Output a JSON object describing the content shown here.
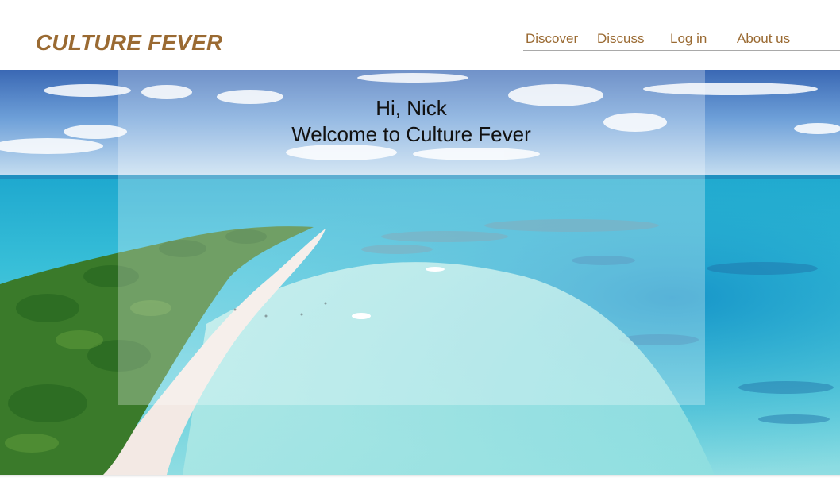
{
  "brand": {
    "name": "CULTURE FEVER",
    "color": "#9a6a32"
  },
  "nav": {
    "items": [
      {
        "label": "Discover"
      },
      {
        "label": "Discuss"
      },
      {
        "label": "Log in"
      },
      {
        "label": "About us"
      }
    ]
  },
  "hero": {
    "greeting_line1": "Hi, Nick",
    "greeting_line2": "Welcome to Culture Fever"
  },
  "colors": {
    "sky": "#5c8fd0",
    "lagoon": "#2db9d6",
    "shallow_water": "#9fe2e6",
    "sand": "#f3e9e4",
    "vegetation": "#3a7a2a"
  }
}
